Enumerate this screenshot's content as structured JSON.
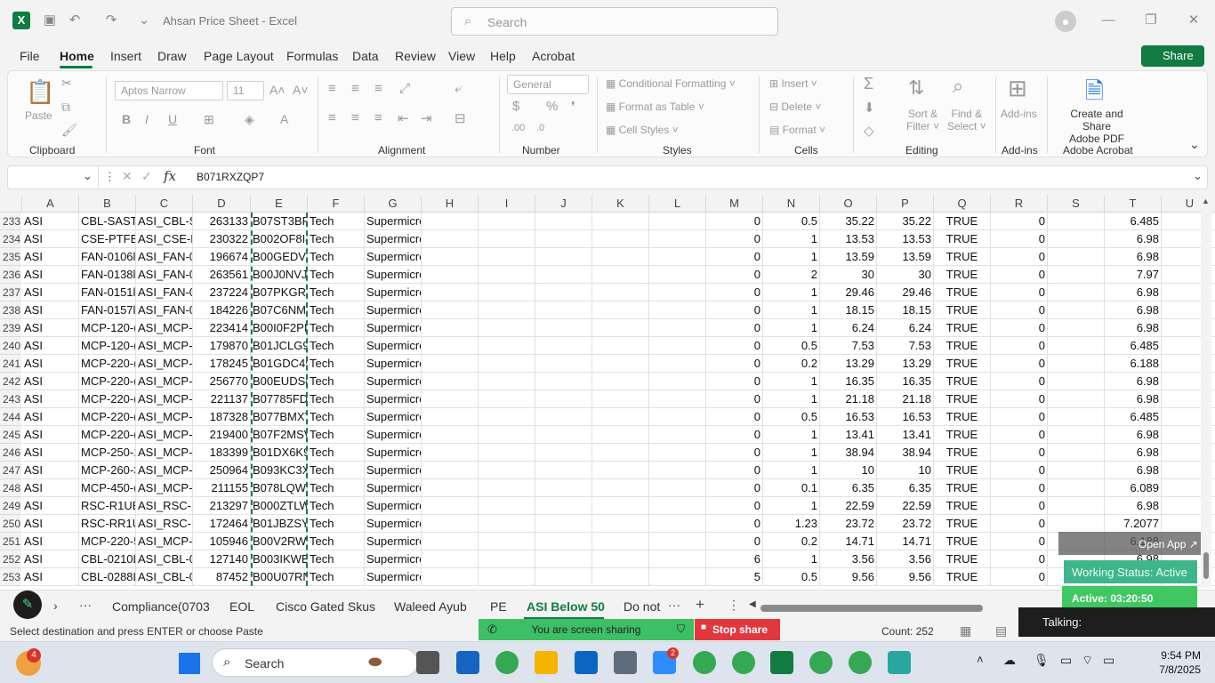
{
  "window": {
    "title": "Ahsan Price Sheet  -  Excel",
    "search_placeholder": "Search"
  },
  "menu": {
    "tabs": [
      "File",
      "Home",
      "Insert",
      "Draw",
      "Page Layout",
      "Formulas",
      "Data",
      "Review",
      "View",
      "Help",
      "Acrobat"
    ],
    "share_label": "Share"
  },
  "ribbon": {
    "clipboard": {
      "label": "Clipboard",
      "paste": "Paste"
    },
    "font": {
      "label": "Font",
      "name": "Aptos Narrow",
      "size": "11"
    },
    "alignment": {
      "label": "Alignment"
    },
    "number": {
      "label": "Number",
      "format": "General"
    },
    "styles": {
      "label": "Styles",
      "cond": "Conditional Formatting",
      "table": "Format as Table",
      "cell": "Cell Styles"
    },
    "cells": {
      "label": "Cells",
      "insert": "Insert",
      "delete": "Delete",
      "format": "Format"
    },
    "editing": {
      "label": "Editing",
      "sort": "Sort &",
      "sort2": "Filter",
      "find": "Find &",
      "find2": "Select"
    },
    "addins": {
      "label": "Add-ins",
      "btn": "Add-ins"
    },
    "acrobat": {
      "label": "Adobe Acrobat",
      "btn1": "Create and Share",
      "btn2": "Adobe PDF"
    }
  },
  "formula_bar": {
    "name_box": "",
    "content": "B071RXZQP7"
  },
  "columns": [
    "A",
    "B",
    "C",
    "D",
    "E",
    "F",
    "G",
    "H",
    "I",
    "J",
    "K",
    "L",
    "M",
    "N",
    "O",
    "P",
    "Q",
    "R",
    "S",
    "T",
    "U"
  ],
  "rows": [
    {
      "num": "233",
      "A": "ASI",
      "B": "CBL-SAST-",
      "C": "ASI_CBL-S/",
      "D": "263133",
      "E": "B07ST3BF",
      "F": "Tech",
      "G": "Supermicro",
      "M": "0",
      "N": "0.5",
      "O": "35.22",
      "P": "35.22",
      "Q": "TRUE",
      "R": "0",
      "T": "6.485"
    },
    {
      "num": "234",
      "A": "ASI",
      "B": "CSE-PTFB-",
      "C": "ASI_CSE-P1",
      "D": "230322",
      "E": "B002OF8I4",
      "F": "Tech",
      "G": "Supermicro",
      "M": "0",
      "N": "1",
      "O": "13.53",
      "P": "13.53",
      "Q": "TRUE",
      "R": "0",
      "T": "6.98"
    },
    {
      "num": "235",
      "A": "ASI",
      "B": "FAN-0106l",
      "C": "ASI_FAN-0",
      "D": "196674",
      "E": "B00GEDV8",
      "F": "Tech",
      "G": "Supermicro",
      "M": "0",
      "N": "1",
      "O": "13.59",
      "P": "13.59",
      "Q": "TRUE",
      "R": "0",
      "T": "6.98"
    },
    {
      "num": "236",
      "A": "ASI",
      "B": "FAN-0138l",
      "C": "ASI_FAN-0",
      "D": "263561",
      "E": "B00J0NVJ0",
      "F": "Tech",
      "G": "Supermicro",
      "M": "0",
      "N": "2",
      "O": "30",
      "P": "30",
      "Q": "TRUE",
      "R": "0",
      "T": "7.97"
    },
    {
      "num": "237",
      "A": "ASI",
      "B": "FAN-0151l",
      "C": "ASI_FAN-0",
      "D": "237224",
      "E": "B07PKGRZ",
      "F": "Tech",
      "G": "Supermicro",
      "M": "0",
      "N": "1",
      "O": "29.46",
      "P": "29.46",
      "Q": "TRUE",
      "R": "0",
      "T": "6.98"
    },
    {
      "num": "238",
      "A": "ASI",
      "B": "FAN-0157l",
      "C": "ASI_FAN-0",
      "D": "184226",
      "E": "B07C6NM",
      "F": "Tech",
      "G": "Supermicro",
      "M": "0",
      "N": "1",
      "O": "18.15",
      "P": "18.15",
      "Q": "TRUE",
      "R": "0",
      "T": "6.98"
    },
    {
      "num": "239",
      "A": "ASI",
      "B": "MCP-120-(",
      "C": "ASI_MCP-1",
      "D": "223414",
      "E": "B00I0F2PI",
      "F": "Tech",
      "G": "Supermicro",
      "M": "0",
      "N": "1",
      "O": "6.24",
      "P": "6.24",
      "Q": "TRUE",
      "R": "0",
      "T": "6.98"
    },
    {
      "num": "240",
      "A": "ASI",
      "B": "MCP-120-(",
      "C": "ASI_MCP-1",
      "D": "179870",
      "E": "B01JCLG9I",
      "F": "Tech",
      "G": "Supermicro",
      "M": "0",
      "N": "0.5",
      "O": "7.53",
      "P": "7.53",
      "Q": "TRUE",
      "R": "0",
      "T": "6.485"
    },
    {
      "num": "241",
      "A": "ASI",
      "B": "MCP-220-(",
      "C": "ASI_MCP-2",
      "D": "178245",
      "E": "B01GDC45",
      "F": "Tech",
      "G": "Supermicro",
      "M": "0",
      "N": "0.2",
      "O": "13.29",
      "P": "13.29",
      "Q": "TRUE",
      "R": "0",
      "T": "6.188"
    },
    {
      "num": "242",
      "A": "ASI",
      "B": "MCP-220-(",
      "C": "ASI_MCP-2",
      "D": "256770",
      "E": "B00EUDS8",
      "F": "Tech",
      "G": "Supermicro",
      "M": "0",
      "N": "1",
      "O": "16.35",
      "P": "16.35",
      "Q": "TRUE",
      "R": "0",
      "T": "6.98"
    },
    {
      "num": "243",
      "A": "ASI",
      "B": "MCP-220-(",
      "C": "ASI_MCP-2",
      "D": "221137",
      "E": "B07785FD",
      "F": "Tech",
      "G": "Supermicro",
      "M": "0",
      "N": "1",
      "O": "21.18",
      "P": "21.18",
      "Q": "TRUE",
      "R": "0",
      "T": "6.98"
    },
    {
      "num": "244",
      "A": "ASI",
      "B": "MCP-220-(",
      "C": "ASI_MCP-2",
      "D": "187328",
      "E": "B077BMXT",
      "F": "Tech",
      "G": "Supermicro",
      "M": "0",
      "N": "0.5",
      "O": "16.53",
      "P": "16.53",
      "Q": "TRUE",
      "R": "0",
      "T": "6.485"
    },
    {
      "num": "245",
      "A": "ASI",
      "B": "MCP-220-(",
      "C": "ASI_MCP-2",
      "D": "219400",
      "E": "B07F2MSV",
      "F": "Tech",
      "G": "Supermicro",
      "M": "0",
      "N": "1",
      "O": "13.41",
      "P": "13.41",
      "Q": "TRUE",
      "R": "0",
      "T": "6.98"
    },
    {
      "num": "246",
      "A": "ASI",
      "B": "MCP-250-1",
      "C": "ASI_MCP-2",
      "D": "183399",
      "E": "B01DX6K9",
      "F": "Tech",
      "G": "Supermicro",
      "M": "0",
      "N": "1",
      "O": "38.94",
      "P": "38.94",
      "Q": "TRUE",
      "R": "0",
      "T": "6.98"
    },
    {
      "num": "247",
      "A": "ASI",
      "B": "MCP-260-3",
      "C": "ASI_MCP-2",
      "D": "250964",
      "E": "B093KC3X",
      "F": "Tech",
      "G": "Supermicro",
      "M": "0",
      "N": "1",
      "O": "10",
      "P": "10",
      "Q": "TRUE",
      "R": "0",
      "T": "6.98"
    },
    {
      "num": "248",
      "A": "ASI",
      "B": "MCP-450-(",
      "C": "ASI_MCP-4",
      "D": "211155",
      "E": "B078LQW(",
      "F": "Tech",
      "G": "Supermicro",
      "M": "0",
      "N": "0.1",
      "O": "6.35",
      "P": "6.35",
      "Q": "TRUE",
      "R": "0",
      "T": "6.089"
    },
    {
      "num": "249",
      "A": "ASI",
      "B": "RSC-R1UE",
      "C": "ASI_RSC-R",
      "D": "213297",
      "E": "B000ZTLW",
      "F": "Tech",
      "G": "Supermicro",
      "M": "0",
      "N": "1",
      "O": "22.59",
      "P": "22.59",
      "Q": "TRUE",
      "R": "0",
      "T": "6.98"
    },
    {
      "num": "250",
      "A": "ASI",
      "B": "RSC-RR1U",
      "C": "ASI_RSC-R",
      "D": "172464",
      "E": "B01JBZSY",
      "F": "Tech",
      "G": "Supermicro",
      "M": "0",
      "N": "1.23",
      "O": "23.72",
      "P": "23.72",
      "Q": "TRUE",
      "R": "0",
      "T": "7.2077"
    },
    {
      "num": "251",
      "A": "ASI",
      "B": "MCP-220-5",
      "C": "ASI_MCP-2",
      "D": "105946",
      "E": "B00V2RWI",
      "F": "Tech",
      "G": "Supermicro",
      "M": "0",
      "N": "0.2",
      "O": "14.71",
      "P": "14.71",
      "Q": "TRUE",
      "R": "0",
      "T": "6.188"
    },
    {
      "num": "252",
      "A": "ASI",
      "B": "CBL-0210L",
      "C": "ASI_CBL-02",
      "D": "127140",
      "E": "B003IKWB",
      "F": "Tech",
      "G": "Supermicro",
      "M": "6",
      "N": "1",
      "O": "3.56",
      "P": "3.56",
      "Q": "TRUE",
      "R": "0",
      "T": "6.98"
    },
    {
      "num": "253",
      "A": "ASI",
      "B": "CBL-0288L",
      "C": "ASI_CBL-02",
      "D": "87452",
      "E": "B00U07RN",
      "F": "Tech",
      "G": "Supermicro",
      "M": "5",
      "N": "0.5",
      "O": "9.56",
      "P": "9.56",
      "Q": "TRUE",
      "R": "0",
      "T": "6.485"
    }
  ],
  "sheet_tabs": [
    "Compliance(0703",
    "EOL",
    "Cisco Gated Skus",
    "Waleed Ayub",
    "PE",
    "ASI Below 50",
    "Do not"
  ],
  "active_sheet": "ASI Below 50",
  "status": {
    "message": "Select destination and press ENTER or choose Paste",
    "sharing": "You are screen sharing",
    "stop_share": "Stop share",
    "count": "Count: 252"
  },
  "overlay": {
    "open_app": "Open App",
    "working_status": "Working Status: Active",
    "active_time": "Active: 03:20:50",
    "talking": "Talking:"
  },
  "taskbar": {
    "search": "Search",
    "notification_badge": "4",
    "zoom_badge": "2",
    "time": "9:54 PM",
    "date": "7/8/2025"
  },
  "colors": {
    "accent": "#107c41",
    "share_green": "#3dbf65",
    "stop_red": "#e0383e"
  }
}
